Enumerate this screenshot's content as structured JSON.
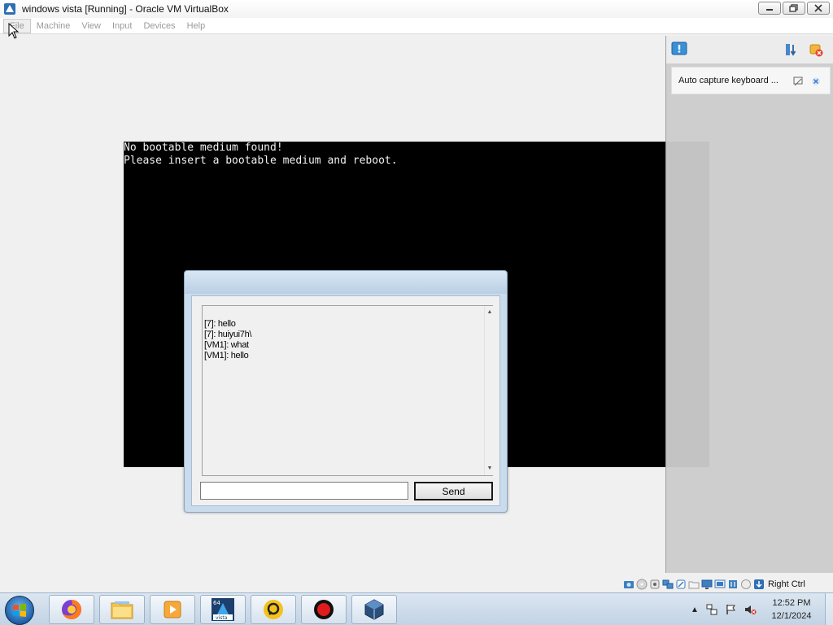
{
  "window": {
    "title": "windows vista [Running] - Oracle VM VirtualBox"
  },
  "menu": {
    "items": [
      "File",
      "Machine",
      "View",
      "Input",
      "Devices",
      "Help"
    ]
  },
  "vm_screen": {
    "line1": "No bootable medium found!",
    "line2": "Please insert a bootable medium and reboot."
  },
  "notification_panel": {
    "card_text": "Auto capture keyboard ...",
    "icons": [
      "notification-center-icon",
      "sort-icon",
      "clear-all-icon",
      "dont-show-icon",
      "close-icon"
    ]
  },
  "chat_dialog": {
    "messages": [
      "[7]: hello",
      "[7]: huiyui7h\\",
      "[VM1]: what",
      "[VM1]: hello"
    ],
    "input_value": "",
    "send_label": "Send"
  },
  "statusbar": {
    "host_key": "Right Ctrl",
    "icons": [
      "hard-disk-icon",
      "optical-drive-icon",
      "audio-icon",
      "network-icon",
      "usb-icon",
      "shared-folders-icon",
      "display-icon",
      "video-capture-icon",
      "cpu-icon",
      "mouse-integration-icon",
      "keyboard-capture-icon"
    ]
  },
  "taskbar": {
    "apps": [
      "firefox-icon",
      "file-explorer-icon",
      "media-player-icon",
      "vista-icon",
      "screen-recorder-icon",
      "record-icon",
      "virtualbox-icon"
    ],
    "clock_time": "12:52 PM",
    "clock_date": "12/1/2024"
  },
  "colors": {
    "vm_background": "#000000",
    "taskbar": "#c2d3e4",
    "dialog_frame": "#c9dbec"
  }
}
